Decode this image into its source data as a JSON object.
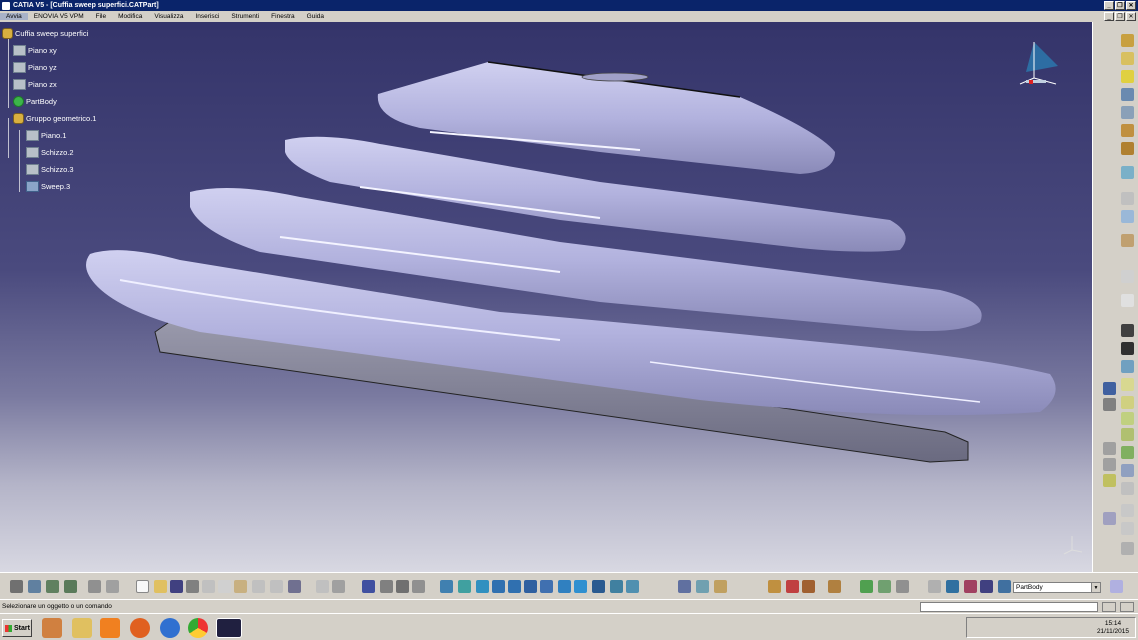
{
  "window": {
    "title": "CATIA V5 - [Cuffia sweep superfici.CATPart]"
  },
  "menu": {
    "items": [
      "Avvia",
      "ENOVIA V5 VPM",
      "File",
      "Modifica",
      "Visualizza",
      "Inserisci",
      "Strumenti",
      "Finestra",
      "Guida"
    ]
  },
  "tree": {
    "root": "Cuffia sweep superfici",
    "piano_xy": "Piano xy",
    "piano_yz": "Piano yz",
    "piano_zx": "Piano zx",
    "partbody": "PartBody",
    "gruppo": "Gruppo geometrico.1",
    "piano1": "Piano.1",
    "schizzo2": "Schizzo.2",
    "schizzo3": "Schizzo.3",
    "sweep3": "Sweep.3"
  },
  "toolbar": {
    "current_body": "PartBody"
  },
  "status": {
    "message": "Selezionare un oggetto o un comando"
  },
  "taskbar": {
    "start_label": "Start",
    "time": "15:14",
    "date": "21/11/2015"
  },
  "colors": {
    "titlebar": "#0a246a",
    "viewport_top": "#34346a",
    "part": "#b9b9e4",
    "part_shade": "#8888b8"
  }
}
